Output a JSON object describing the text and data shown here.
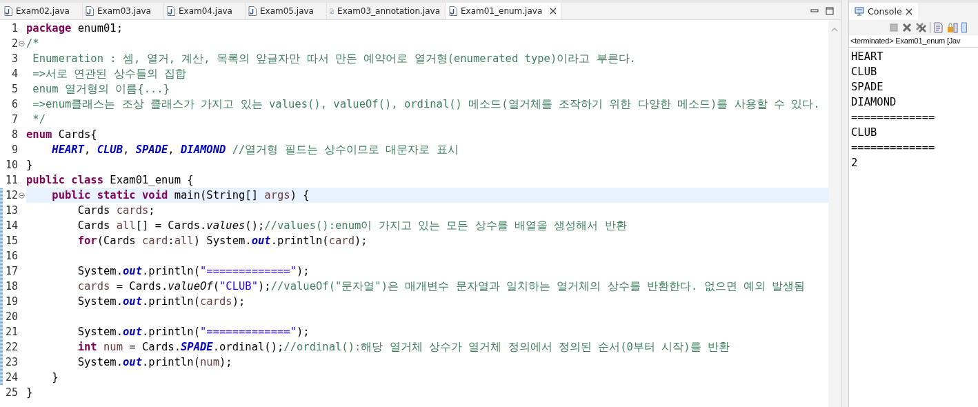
{
  "editor": {
    "tabs": [
      {
        "label": "Exam02.java",
        "selected": false
      },
      {
        "label": "Exam03.java",
        "selected": false
      },
      {
        "label": "Exam04.java",
        "selected": false
      },
      {
        "label": "Exam05.java",
        "selected": false
      },
      {
        "label": "Exam03_annotation.java",
        "selected": false
      },
      {
        "label": "Exam01_enum.java",
        "selected": true
      }
    ],
    "lines": [
      {
        "number": "1",
        "fold": false,
        "current": false,
        "changed": false,
        "tokens": [
          {
            "kind": "keyword",
            "text": "package"
          },
          {
            "kind": "plain",
            "text": " enum01;"
          }
        ]
      },
      {
        "number": "2",
        "fold": true,
        "current": false,
        "changed": false,
        "tokens": [
          {
            "kind": "comment",
            "text": "/*"
          }
        ]
      },
      {
        "number": "3",
        "fold": false,
        "current": false,
        "changed": false,
        "tokens": [
          {
            "kind": "comment",
            "text": " Enumeration : 셈, 열거, 계산, 목록의 앞글자만 따서 만든 예약어로 열거형(enumerated type)이라고 부른다."
          }
        ]
      },
      {
        "number": "4",
        "fold": false,
        "current": false,
        "changed": false,
        "tokens": [
          {
            "kind": "comment",
            "text": " =>서로 연관된 상수들의 집합"
          }
        ]
      },
      {
        "number": "5",
        "fold": false,
        "current": false,
        "changed": false,
        "tokens": [
          {
            "kind": "comment",
            "text": " enum 열거형의 이름{...}"
          }
        ]
      },
      {
        "number": "6",
        "fold": false,
        "current": false,
        "changed": false,
        "tokens": [
          {
            "kind": "comment",
            "text": " =>enum클래스는 조상 클래스가 가지고 있는 values(), valueOf(), ordinal() 메소드(열거체를 조작하기 위한 다양한 메소드)를 사용할 수 있다."
          }
        ]
      },
      {
        "number": "7",
        "fold": false,
        "current": false,
        "changed": false,
        "tokens": [
          {
            "kind": "comment",
            "text": " */"
          }
        ]
      },
      {
        "number": "8",
        "fold": false,
        "current": false,
        "changed": false,
        "tokens": [
          {
            "kind": "keyword",
            "text": "enum"
          },
          {
            "kind": "plain",
            "text": " Cards{"
          }
        ]
      },
      {
        "number": "9",
        "fold": false,
        "current": false,
        "changed": false,
        "tokens": [
          {
            "kind": "constant",
            "text": "    HEART"
          },
          {
            "kind": "plain",
            "text": ", "
          },
          {
            "kind": "constant",
            "text": "CLUB"
          },
          {
            "kind": "plain",
            "text": ", "
          },
          {
            "kind": "constant",
            "text": "SPADE"
          },
          {
            "kind": "plain",
            "text": ", "
          },
          {
            "kind": "constant",
            "text": "DIAMOND"
          },
          {
            "kind": "comment",
            "text": " //열거형 필드는 상수이므로 대문자로 표시"
          }
        ]
      },
      {
        "number": "10",
        "fold": false,
        "current": false,
        "changed": false,
        "tokens": [
          {
            "kind": "plain",
            "text": "}"
          }
        ]
      },
      {
        "number": "11",
        "fold": false,
        "current": false,
        "changed": false,
        "tokens": [
          {
            "kind": "keyword",
            "text": "public class"
          },
          {
            "kind": "plain",
            "text": " Exam01_enum {"
          }
        ]
      },
      {
        "number": "12",
        "fold": true,
        "current": true,
        "changed": true,
        "tokens": [
          {
            "kind": "keyword",
            "text": "    public static void"
          },
          {
            "kind": "plain",
            "text": " main(String[] "
          },
          {
            "kind": "variable",
            "text": "args"
          },
          {
            "kind": "plain",
            "text": ") {"
          }
        ]
      },
      {
        "number": "13",
        "fold": false,
        "current": false,
        "changed": true,
        "tokens": [
          {
            "kind": "plain",
            "text": "        Cards "
          },
          {
            "kind": "variable",
            "text": "cards"
          },
          {
            "kind": "plain",
            "text": ";"
          }
        ]
      },
      {
        "number": "14",
        "fold": false,
        "current": false,
        "changed": true,
        "tokens": [
          {
            "kind": "plain",
            "text": "        Cards "
          },
          {
            "kind": "variable",
            "text": "all"
          },
          {
            "kind": "plain",
            "text": "[] = Cards."
          },
          {
            "kind": "static",
            "text": "values"
          },
          {
            "kind": "plain",
            "text": "();"
          },
          {
            "kind": "comment",
            "text": "//values():enum이 가지고 있는 모든 상수를 배열을 생성해서 반환"
          }
        ]
      },
      {
        "number": "15",
        "fold": false,
        "current": false,
        "changed": true,
        "tokens": [
          {
            "kind": "keyword",
            "text": "        for"
          },
          {
            "kind": "plain",
            "text": "(Cards "
          },
          {
            "kind": "variable",
            "text": "card"
          },
          {
            "kind": "plain",
            "text": ":"
          },
          {
            "kind": "variable",
            "text": "all"
          },
          {
            "kind": "plain",
            "text": ") System."
          },
          {
            "kind": "constant",
            "text": "out"
          },
          {
            "kind": "plain",
            "text": ".println("
          },
          {
            "kind": "variable",
            "text": "card"
          },
          {
            "kind": "plain",
            "text": ");"
          }
        ]
      },
      {
        "number": "16",
        "fold": false,
        "current": false,
        "changed": true
      },
      {
        "number": "17",
        "fold": false,
        "current": false,
        "changed": true,
        "tokens": [
          {
            "kind": "plain",
            "text": "        System."
          },
          {
            "kind": "constant",
            "text": "out"
          },
          {
            "kind": "plain",
            "text": ".println("
          },
          {
            "kind": "string",
            "text": "\"=============\""
          },
          {
            "kind": "plain",
            "text": ");"
          }
        ]
      },
      {
        "number": "18",
        "fold": false,
        "current": false,
        "changed": true,
        "tokens": [
          {
            "kind": "variable",
            "text": "        cards"
          },
          {
            "kind": "plain",
            "text": " = Cards."
          },
          {
            "kind": "static",
            "text": "valueOf"
          },
          {
            "kind": "plain",
            "text": "("
          },
          {
            "kind": "string",
            "text": "\"CLUB\""
          },
          {
            "kind": "plain",
            "text": ");"
          },
          {
            "kind": "comment",
            "text": "//valueOf(\"문자열\")은 매개변수 문자열과 일치하는 열거체의 상수를 반환한다. 없으면 예외 발생됨"
          }
        ]
      },
      {
        "number": "19",
        "fold": false,
        "current": false,
        "changed": true,
        "tokens": [
          {
            "kind": "plain",
            "text": "        System."
          },
          {
            "kind": "constant",
            "text": "out"
          },
          {
            "kind": "plain",
            "text": ".println("
          },
          {
            "kind": "variable",
            "text": "cards"
          },
          {
            "kind": "plain",
            "text": ");"
          }
        ]
      },
      {
        "number": "20",
        "fold": false,
        "current": false,
        "changed": true
      },
      {
        "number": "21",
        "fold": false,
        "current": false,
        "changed": true,
        "tokens": [
          {
            "kind": "plain",
            "text": "        System."
          },
          {
            "kind": "constant",
            "text": "out"
          },
          {
            "kind": "plain",
            "text": ".println("
          },
          {
            "kind": "string",
            "text": "\"=============\""
          },
          {
            "kind": "plain",
            "text": ");"
          }
        ]
      },
      {
        "number": "22",
        "fold": false,
        "current": false,
        "changed": true,
        "tokens": [
          {
            "kind": "keyword",
            "text": "        int"
          },
          {
            "kind": "variable",
            "text": " num"
          },
          {
            "kind": "plain",
            "text": " = Cards."
          },
          {
            "kind": "constant",
            "text": "SPADE"
          },
          {
            "kind": "plain",
            "text": ".ordinal();"
          },
          {
            "kind": "comment",
            "text": "//ordinal():해당 열거체 상수가 열거체 정의에서 정의된 순서(0부터 시작)를 반환"
          }
        ]
      },
      {
        "number": "23",
        "fold": false,
        "current": false,
        "changed": true,
        "tokens": [
          {
            "kind": "plain",
            "text": "        System."
          },
          {
            "kind": "constant",
            "text": "out"
          },
          {
            "kind": "plain",
            "text": ".println("
          },
          {
            "kind": "variable",
            "text": "num"
          },
          {
            "kind": "plain",
            "text": ");"
          }
        ]
      },
      {
        "number": "24",
        "fold": false,
        "current": false,
        "changed": true,
        "tokens": [
          {
            "kind": "bracket",
            "text": "    }"
          }
        ]
      },
      {
        "number": "25",
        "fold": false,
        "current": false,
        "changed": false,
        "tokens": [
          {
            "kind": "plain",
            "text": "}"
          }
        ]
      }
    ]
  },
  "console": {
    "title": "Console",
    "status": "<terminated> Exam01_enum [Jav",
    "output": [
      "HEART",
      "CLUB",
      "SPADE",
      "DIAMOND",
      "=============",
      "CLUB",
      "=============",
      "2"
    ]
  }
}
